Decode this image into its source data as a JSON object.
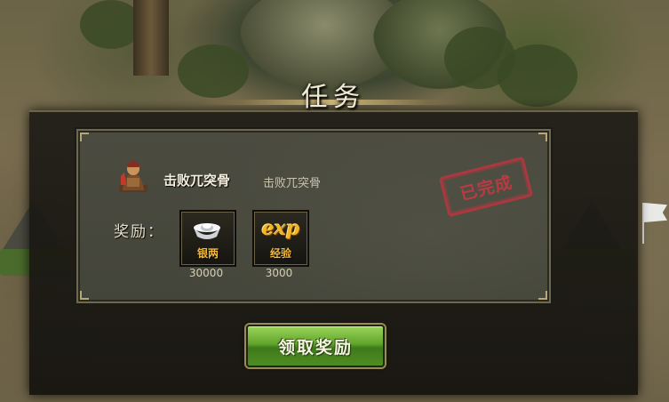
{
  "dialog": {
    "title": "任务",
    "claim_button_label": "领取奖励"
  },
  "quest": {
    "name": "击败兀突骨",
    "description": "击败兀突骨",
    "status_stamp": "已完成",
    "icon": "warrior-portrait-icon"
  },
  "rewards": {
    "label": "奖励：",
    "items": [
      {
        "name": "银两",
        "amount": "30000",
        "icon": "silver-ingot-icon"
      },
      {
        "name": "经验",
        "amount": "3000",
        "icon": "exp-icon",
        "glyph": "exp"
      }
    ]
  },
  "colors": {
    "stamp_red": "#c43a45",
    "reward_gold": "#f3b93a",
    "button_green": "#61a42c"
  }
}
